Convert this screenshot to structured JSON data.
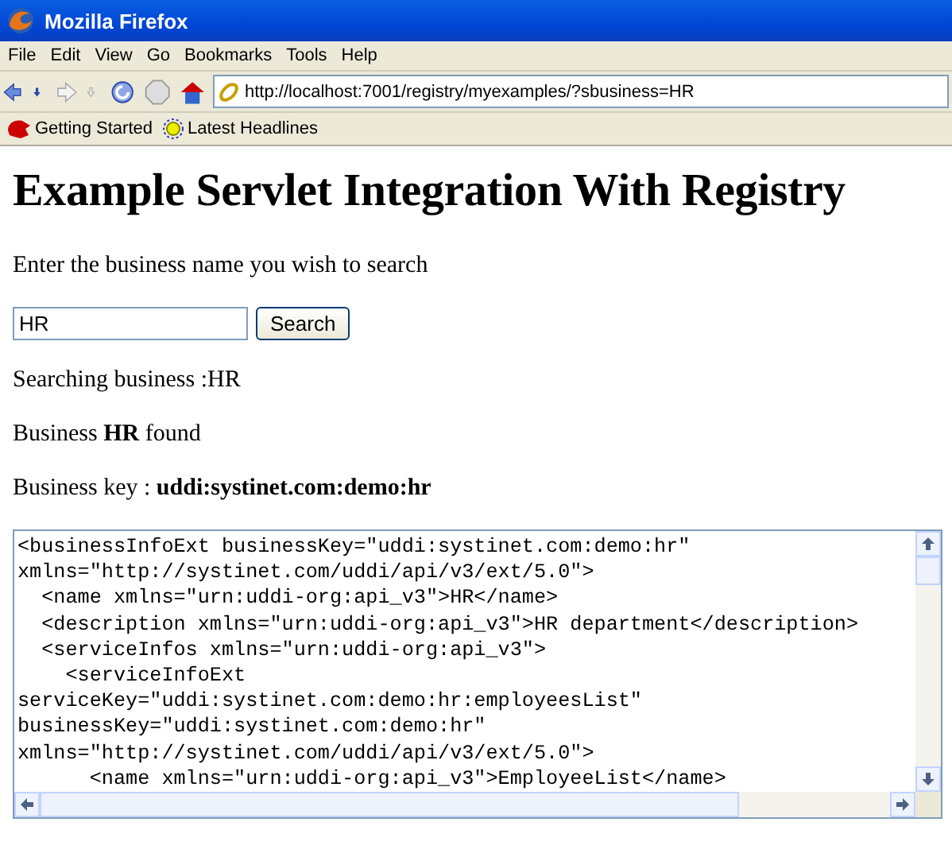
{
  "window": {
    "title": "Mozilla Firefox"
  },
  "menu": [
    "File",
    "Edit",
    "View",
    "Go",
    "Bookmarks",
    "Tools",
    "Help"
  ],
  "address": {
    "value": "http://localhost:7001/registry/myexamples/?sbusiness=HR"
  },
  "bookmarks": [
    {
      "label": "Getting Started",
      "kind": "start"
    },
    {
      "label": "Latest Headlines",
      "kind": "feed"
    }
  ],
  "page": {
    "heading": "Example Servlet Integration With Registry",
    "prompt": "Enter the business name you wish to search",
    "search": {
      "value": "HR",
      "button": "Search"
    },
    "status": "Searching business :HR",
    "found": "Business **HR** found",
    "key": "Business key : **uddi:systinet.com:demo:hr**",
    "xml_lines": [
      "<businessInfoExt businessKey=\"uddi:systinet.com:demo:hr\"",
      "xmlns=\"http://systinet.com/uddi/api/v3/ext/5.0\">",
      "  <name xmlns=\"urn:uddi-org:api_v3\">HR</name>",
      "  <description xmlns=\"urn:uddi-org:api_v3\">HR department</description>",
      "  <serviceInfos xmlns=\"urn:uddi-org:api_v3\">",
      "    <serviceInfoExt",
      "serviceKey=\"uddi:systinet.com:demo:hr:employeesList\"",
      "businessKey=\"uddi:systinet.com:demo:hr\"",
      "xmlns=\"http://systinet.com/uddi/api/v3/ext/5.0\">",
      "      <name xmlns=\"urn:uddi-org:api_v3\">EmployeeList</name>"
    ]
  }
}
